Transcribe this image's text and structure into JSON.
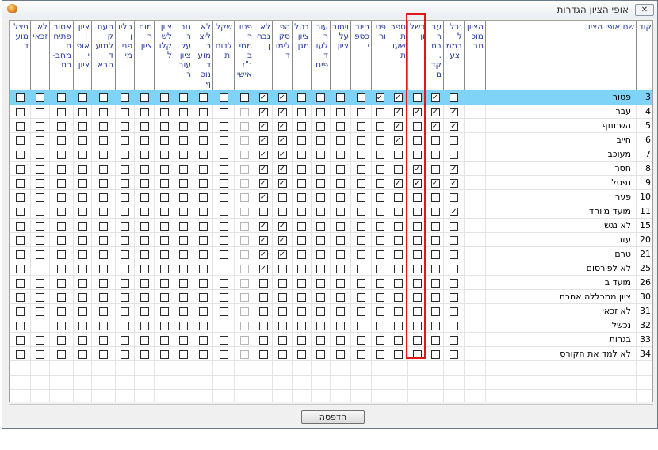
{
  "window": {
    "title": "אופי הציון הגדרות",
    "close_icon": "close-icon",
    "app_icon": "app-icon"
  },
  "columns": [
    {
      "key": "code",
      "label": "קוד"
    },
    {
      "key": "name",
      "label": "שם אופי הציון"
    },
    {
      "key": "c1",
      "label": "הציון מוכתב"
    },
    {
      "key": "c2",
      "label": "נכלל בממוצע"
    },
    {
      "key": "c3",
      "label": "עבר בת. קדם"
    },
    {
      "key": "c4",
      "label": "כשלון"
    },
    {
      "key": "c5",
      "label": "ספרת שעות"
    },
    {
      "key": "c6",
      "label": "פטור"
    },
    {
      "key": "c7",
      "label": "חיוב כספי"
    },
    {
      "key": "c8",
      "label": "ויתור על ציון"
    },
    {
      "key": "c9",
      "label": "עובר לעוד פים"
    },
    {
      "key": "c10",
      "label": "בטל ציון מגן"
    },
    {
      "key": "c11",
      "label": "הפסק לימוד"
    },
    {
      "key": "c12",
      "label": "לא נבחן"
    },
    {
      "key": "c13",
      "label": "פטור מחיב נ\"ז אישי"
    },
    {
      "key": "c14",
      "label": "שקלו לדוחות"
    },
    {
      "key": "c15",
      "label": "לא ליצר מועד נוסף"
    },
    {
      "key": "c16",
      "label": "גובר על ציון עובר"
    },
    {
      "key": "c17",
      "label": "ציון לשקלול"
    },
    {
      "key": "c18",
      "label": "מותר ציון"
    },
    {
      "key": "c19",
      "label": "גיליון פנימי"
    },
    {
      "key": "c20",
      "label": "העתק למועד הבא"
    },
    {
      "key": "c21",
      "label": "ציון + אופי ציון"
    },
    {
      "key": "c22",
      "label": "אסור פתיחת מחב- רת"
    },
    {
      "key": "c23",
      "label": "לא זכאי"
    },
    {
      "key": "c24",
      "label": "ניצל מועד"
    }
  ],
  "highlighted_column": "c4",
  "selected_row": 0,
  "rows": [
    {
      "code": "3",
      "name": "פטור",
      "checked": [
        "c3",
        "c5",
        "c6",
        "c11",
        "c12"
      ]
    },
    {
      "code": "4",
      "name": "עבר",
      "checked": [
        "c2",
        "c3",
        "c4",
        "c5",
        "c11",
        "c12"
      ]
    },
    {
      "code": "5",
      "name": "השתתף",
      "checked": [
        "c2",
        "c3",
        "c5",
        "c11",
        "c12"
      ]
    },
    {
      "code": "6",
      "name": "חייב",
      "checked": [
        "c5",
        "c11",
        "c12"
      ]
    },
    {
      "code": "7",
      "name": "מעוכב",
      "checked": [
        "c11",
        "c12"
      ]
    },
    {
      "code": "8",
      "name": "חסר",
      "checked": [
        "c2",
        "c4",
        "c11",
        "c12"
      ]
    },
    {
      "code": "9",
      "name": "נפסל",
      "checked": [
        "c2",
        "c3",
        "c4",
        "c5",
        "c11",
        "c12"
      ]
    },
    {
      "code": "10",
      "name": "פער",
      "checked": [
        "c12"
      ]
    },
    {
      "code": "11",
      "name": "מועד מיוחד",
      "checked": [
        "c2"
      ]
    },
    {
      "code": "15",
      "name": "לא נגש",
      "checked": [
        "c11",
        "c12"
      ]
    },
    {
      "code": "20",
      "name": "עזב",
      "checked": [
        "c11",
        "c12"
      ]
    },
    {
      "code": "21",
      "name": "טרם",
      "checked": [
        "c11",
        "c12"
      ]
    },
    {
      "code": "25",
      "name": "לא לפירסום",
      "checked": [
        "c12"
      ]
    },
    {
      "code": "26",
      "name": "מועד ב",
      "checked": []
    },
    {
      "code": "30",
      "name": "ציון ממכללה אחרת",
      "checked": []
    },
    {
      "code": "31",
      "name": "לא זכאי",
      "checked": []
    },
    {
      "code": "32",
      "name": "נכשל",
      "checked": []
    },
    {
      "code": "33",
      "name": "בגרות",
      "checked": []
    },
    {
      "code": "34",
      "name": "לא למד את הקורס",
      "checked": []
    }
  ],
  "footer": {
    "print_label": "הדפסה"
  }
}
